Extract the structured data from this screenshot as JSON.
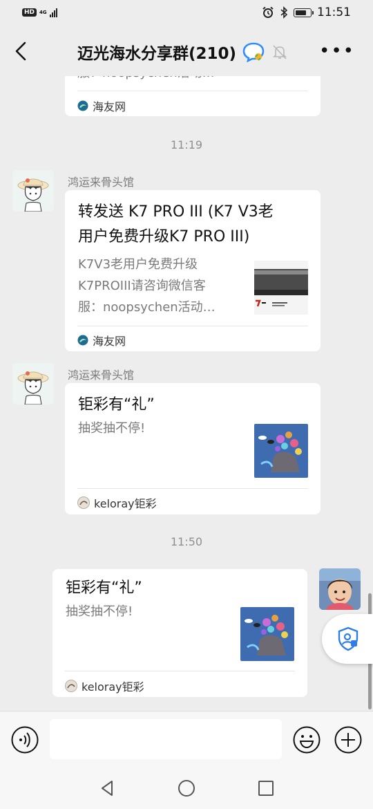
{
  "status_bar": {
    "network_badge": "HD",
    "network_gen": "4G",
    "time": "11:51"
  },
  "header": {
    "title": "迈光海水分享群(210)",
    "back_icon": "chevron-left-icon",
    "more_icon": "more-icon"
  },
  "messages": [
    {
      "type": "partial_card",
      "desc_tail": "服：noopsychen活动…",
      "source": "海友网"
    },
    {
      "type": "time",
      "text": "11:19"
    },
    {
      "type": "card",
      "sender": "鸿运来骨头馆",
      "title_lines": [
        "转发送 K7 PRO III (K7 V3老",
        "用户免费升级K7 PRO III)"
      ],
      "desc_lines": [
        "K7V3老用户免费升级",
        "K7PROIII请咨询微信客",
        "服：noopsychen活动…"
      ],
      "source": "海友网"
    },
    {
      "type": "card",
      "sender": "鸿运来骨头馆",
      "title": "钜彩有“礼”",
      "desc": "抽奖抽不停!",
      "source": "keloray钜彩"
    },
    {
      "type": "time",
      "text": "11:50"
    },
    {
      "type": "card_self",
      "title": "钜彩有“礼”",
      "desc": "抽奖抽不停!",
      "source": "keloray钜彩"
    }
  ],
  "input_bar": {
    "voice_icon": "voice-icon",
    "emoji_icon": "emoji-icon",
    "add_icon": "plus-icon",
    "value": ""
  },
  "nav_bar": {
    "back": "nav-back-icon",
    "home": "nav-home-icon",
    "recent": "nav-recent-icon"
  },
  "colors": {
    "background": "#ededed",
    "bubble": "#ffffff",
    "accent_blue": "#2f8cff"
  }
}
